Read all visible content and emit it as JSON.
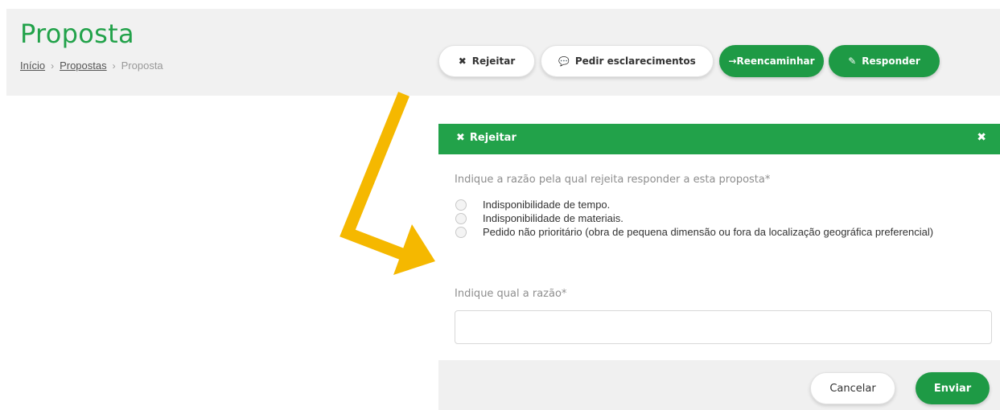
{
  "header": {
    "title": "Proposta",
    "breadcrumb": [
      "Início",
      "Propostas",
      "Proposta"
    ],
    "breadcrumb_separator": "›"
  },
  "actions": {
    "rejeitar": {
      "icon": "✖",
      "label": "Rejeitar"
    },
    "pedir": {
      "icon": "💬",
      "label": "Pedir esclarecimentos"
    },
    "reencaminhar": {
      "icon": "→",
      "label": "Reencaminhar"
    },
    "responder": {
      "icon": "✎",
      "label": "Responder"
    }
  },
  "modal": {
    "title_icon": "✖",
    "title": "Rejeitar",
    "close_icon": "✖",
    "question": "Indique a razão pela qual rejeita responder a esta proposta*",
    "options": [
      "Indisponibilidade de tempo.",
      "Indisponibilidade de materiais.",
      "Pedido não prioritário (obra de pequena dimensão ou fora da localização geográfica preferencial)"
    ],
    "reason_label": "Indique qual a razão*",
    "reason_value": "",
    "cancel_label": "Cancelar",
    "send_label": "Enviar"
  },
  "colors": {
    "brand_green": "#22a24a",
    "annotation_arrow": "#f5b800"
  }
}
